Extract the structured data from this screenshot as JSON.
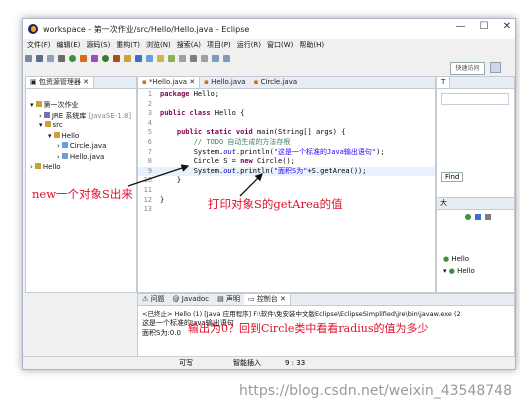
{
  "window": {
    "title": "workspace - 第一次作业/src/Hello/Hello.java - Eclipse",
    "controls": [
      "—",
      "☐",
      "✕"
    ]
  },
  "menu": [
    "文件(F)",
    "编辑(E)",
    "源码(S)",
    "重构(T)",
    "浏览(N)",
    "搜索(A)",
    "项目(P)",
    "运行(R)",
    "窗口(W)",
    "帮助(H)"
  ],
  "quick_access": "快速访问",
  "package_explorer": {
    "tab_label": "包资源管理器",
    "tree": [
      {
        "label": "第一次作业",
        "depth": 0,
        "arrow": "▾",
        "icon": "project"
      },
      {
        "label": "JRE 系统库",
        "extra": "[JavaSE-1.8]",
        "depth": 1,
        "arrow": "›",
        "icon": "library"
      },
      {
        "label": "src",
        "depth": 1,
        "arrow": "▾",
        "icon": "folder"
      },
      {
        "label": "Hello",
        "depth": 2,
        "arrow": "▾",
        "icon": "package"
      },
      {
        "label": "Circle.java",
        "depth": 3,
        "arrow": "›",
        "icon": "java-file"
      },
      {
        "label": "Hello.java",
        "depth": 3,
        "arrow": "›",
        "icon": "java-file"
      },
      {
        "label": "Hello",
        "depth": 0,
        "arrow": "›",
        "icon": "project"
      }
    ]
  },
  "editor": {
    "tabs": [
      "*Hello.java",
      "Hello.java",
      "Circle.java"
    ],
    "lines": [
      {
        "num": "1",
        "segments": [
          {
            "t": "package ",
            "c": "kw"
          },
          {
            "t": "Hello;",
            "c": ""
          }
        ]
      },
      {
        "num": "2",
        "segments": []
      },
      {
        "num": "3",
        "segments": [
          {
            "t": "public class ",
            "c": "kw"
          },
          {
            "t": "Hello {",
            "c": ""
          }
        ]
      },
      {
        "num": "4",
        "segments": []
      },
      {
        "num": "5",
        "segments": [
          {
            "t": "    public static void ",
            "c": "kw"
          },
          {
            "t": "main(String[] args) {",
            "c": ""
          }
        ]
      },
      {
        "num": "6",
        "segments": [
          {
            "t": "        // TODO 自动生成的方法存根",
            "c": "cm"
          }
        ]
      },
      {
        "num": "7",
        "segments": [
          {
            "t": "        System.",
            "c": ""
          },
          {
            "t": "out",
            "c": "fld"
          },
          {
            "t": ".println(",
            "c": ""
          },
          {
            "t": "\"这是一个标准的Java输出语句\"",
            "c": "str"
          },
          {
            "t": ");",
            "c": ""
          }
        ]
      },
      {
        "num": "8",
        "segments": [
          {
            "t": "        Circle S = ",
            "c": ""
          },
          {
            "t": "new ",
            "c": "kw"
          },
          {
            "t": "Circle();",
            "c": ""
          }
        ]
      },
      {
        "num": "9",
        "segments": [
          {
            "t": "        System.",
            "c": ""
          },
          {
            "t": "out",
            "c": "fld"
          },
          {
            "t": ".println(",
            "c": ""
          },
          {
            "t": "\"面积S为\"",
            "c": "str"
          },
          {
            "t": "+S.getArea());",
            "c": ""
          }
        ]
      },
      {
        "num": "10",
        "segments": [
          {
            "t": "    }",
            "c": ""
          }
        ]
      },
      {
        "num": "11",
        "segments": []
      },
      {
        "num": "12",
        "segments": [
          {
            "t": "}",
            "c": ""
          }
        ]
      },
      {
        "num": "13",
        "segments": []
      }
    ]
  },
  "right_panel": {
    "tabs": [
      "T",
      "大"
    ],
    "find_label": "Find",
    "outline_items": [
      "Hello",
      "Hello"
    ]
  },
  "console": {
    "tabs": [
      "问题",
      "Javadoc",
      "声明",
      "控制台"
    ],
    "header": "<已终止> Hello (1) [Java 应用程序] F:\\软件\\免安装中文版Eclipse\\EclipseSimplified\\jre\\bin\\javaw.exe (2",
    "output": [
      "这是一个标准的Java输出语句",
      "面积S为:0.0"
    ]
  },
  "statusbar": {
    "writable": "可写",
    "insert_mode": "智能插入",
    "position": "9 : 33"
  },
  "annotations": {
    "new_object": "new一个对象S出来",
    "print_area": "打印对象S的getArea的值",
    "output_question": "输出为0？回到Circle类中看看radius的值为多少"
  },
  "watermark": "https://blog.csdn.net/weixin_43548748",
  "colors": {
    "annotation": "#e0102a",
    "keyword": "#7f0055",
    "comment": "#3f7f5f",
    "string": "#2a00ff"
  }
}
